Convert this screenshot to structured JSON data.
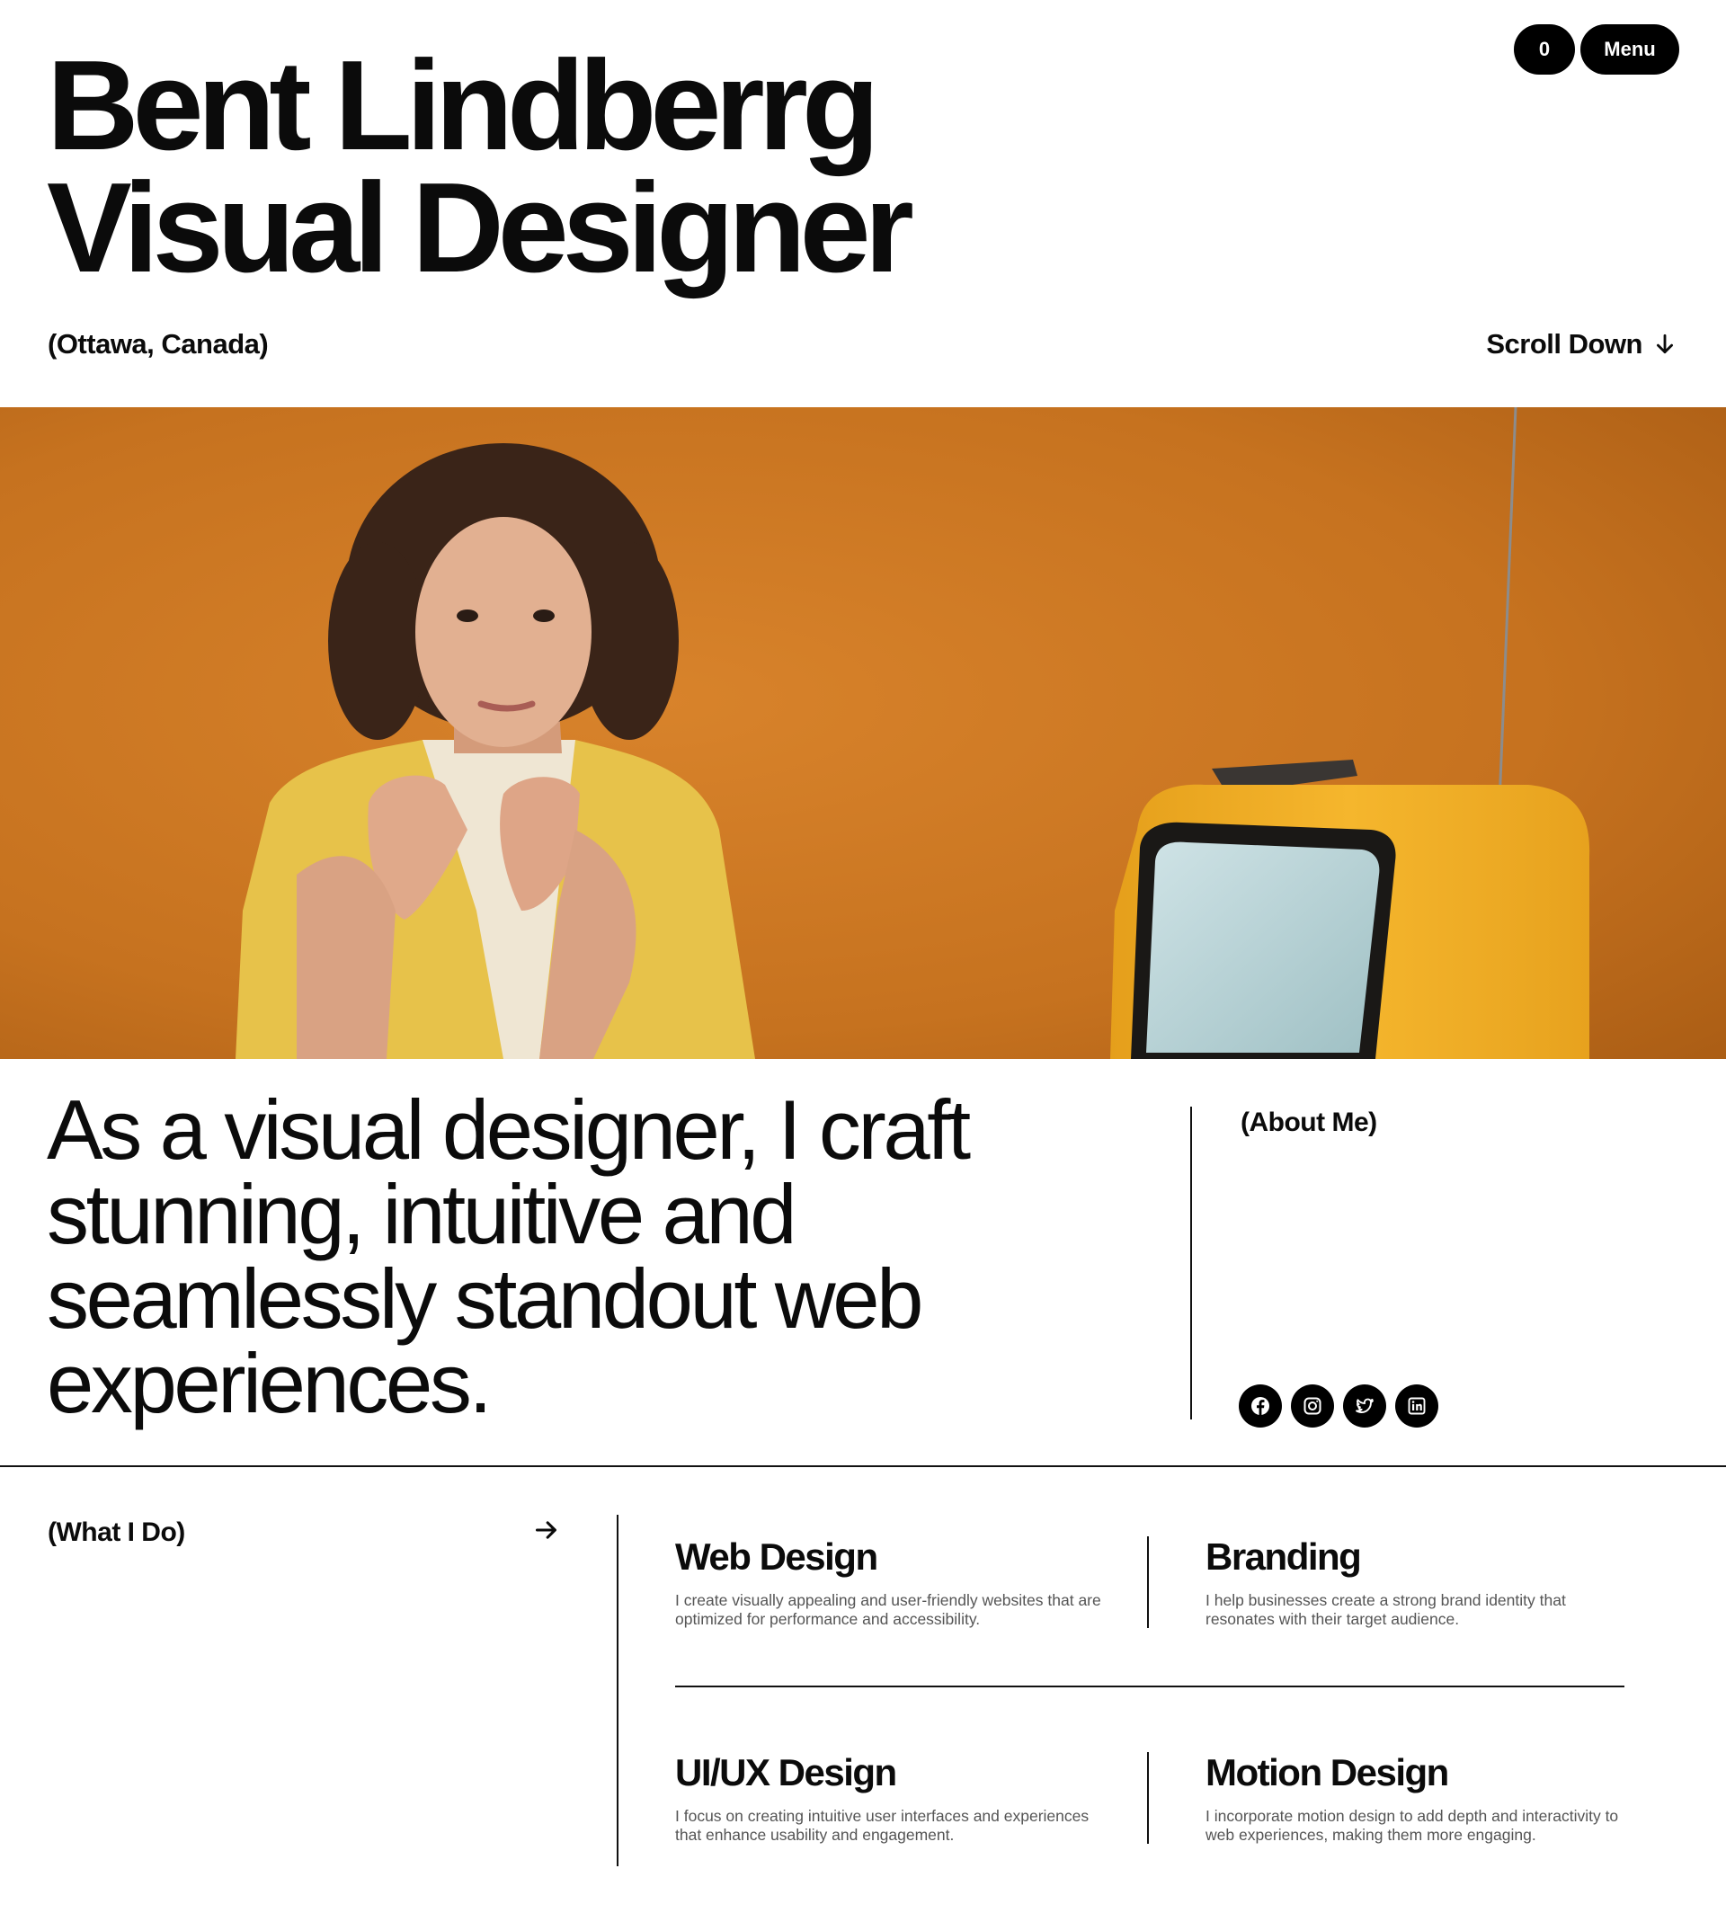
{
  "header": {
    "title_line1": "Bent Lindberrg",
    "title_line2": "Visual Designer",
    "cart_count": "0",
    "menu_label": "Menu",
    "location": "(Ottawa, Canada)",
    "scroll_label": "Scroll Down"
  },
  "about": {
    "statement": "As a visual designer, I craft stunning, intuitive and seamlessly standout web experiences.",
    "label": "(About Me)",
    "socials": [
      {
        "icon": "facebook-icon"
      },
      {
        "icon": "instagram-icon"
      },
      {
        "icon": "twitter-icon"
      },
      {
        "icon": "linkedin-icon"
      }
    ]
  },
  "services": {
    "label": "(What I Do)",
    "items": [
      {
        "title": "Web Design",
        "description": "I create visually appealing and user-friendly websites that are optimized for performance and accessibility."
      },
      {
        "title": "Branding",
        "description": "I help businesses create a strong brand identity that resonates with their target audience."
      },
      {
        "title": "UI/UX Design",
        "description": "I focus on creating intuitive user interfaces and experiences that enhance usability and engagement."
      },
      {
        "title": "Motion Design",
        "description": "I incorporate motion design to add depth and interactivity to web experiences, making them more engaging."
      }
    ]
  },
  "colors": {
    "background": "#ffffff",
    "text": "#0b0b0b",
    "accent_orange": "#c9741f",
    "shirt_yellow": "#e8c44a",
    "tv_yellow": "#f0b025"
  }
}
